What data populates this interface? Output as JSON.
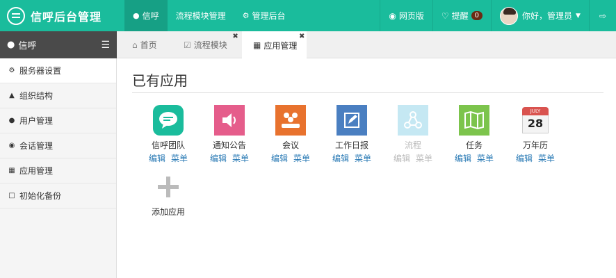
{
  "header": {
    "brand": "信呼后台管理",
    "nav": [
      {
        "label": "信呼",
        "icon": "chat-bubble-icon"
      },
      {
        "label": "流程模块管理",
        "icon": ""
      },
      {
        "label": "管理后台",
        "icon": "gear-icon"
      }
    ],
    "web_version": "网页版",
    "reminder": "提醒",
    "reminder_count": "0",
    "greeting": "你好，管理员"
  },
  "sidebar": {
    "title": "信呼",
    "items": [
      {
        "label": "服务器设置",
        "icon": "gear-icon"
      },
      {
        "label": "组织结构",
        "icon": "sitemap-icon"
      },
      {
        "label": "用户管理",
        "icon": "user-icon"
      },
      {
        "label": "会话管理",
        "icon": "comments-icon"
      },
      {
        "label": "应用管理",
        "icon": "grid-icon"
      },
      {
        "label": "初始化备份",
        "icon": "bookmark-icon"
      }
    ]
  },
  "tabs": [
    {
      "label": "首页",
      "icon": "home-icon"
    },
    {
      "label": "流程模块",
      "icon": "check-square-icon"
    },
    {
      "label": "应用管理",
      "icon": "grid-icon"
    }
  ],
  "main": {
    "title": "已有应用",
    "edit_label": "编辑",
    "menu_label": "菜单",
    "apps": [
      {
        "name": "信呼团队",
        "color": "#1abc9c"
      },
      {
        "name": "通知公告",
        "color": "#e55d8b"
      },
      {
        "name": "会议",
        "color": "#e8722e"
      },
      {
        "name": "工作日报",
        "color": "#4a7fc1"
      },
      {
        "name": "流程",
        "color": "#5bc0de"
      },
      {
        "name": "任务",
        "color": "#7cc44c"
      },
      {
        "name": "万年历",
        "color": "#d9534f",
        "month": "JULY",
        "day": "28"
      }
    ],
    "add_app": "添加应用"
  }
}
